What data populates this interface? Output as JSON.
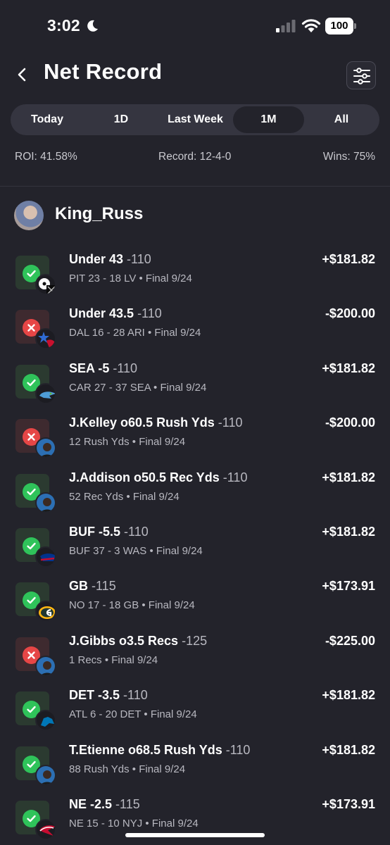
{
  "status_bar": {
    "time": "3:02",
    "battery": "100"
  },
  "header": {
    "title": "Net Record"
  },
  "tabs": [
    {
      "label": "Today",
      "active": false
    },
    {
      "label": "1D",
      "active": false
    },
    {
      "label": "Last Week",
      "active": false
    },
    {
      "label": "1M",
      "active": true
    },
    {
      "label": "All",
      "active": false
    }
  ],
  "stats": {
    "roi": "ROI: 41.58%",
    "record": "Record: 12-4-0",
    "wins": "Wins: 75%"
  },
  "user": {
    "name": "King_Russ"
  },
  "colors": {
    "background": "#23232b",
    "win": "#2fc35a",
    "loss": "#e64646"
  },
  "bets": [
    {
      "title": "Under 43",
      "odds": "-110",
      "detail": "PIT 23 - 18 LV • Final 9/24",
      "amount": "+$181.82",
      "result": "win",
      "icon": "steelers-raiders-logo"
    },
    {
      "title": "Under 43.5",
      "odds": "-110",
      "detail": "DAL 16 - 28 ARI • Final 9/24",
      "amount": "-$200.00",
      "result": "loss",
      "icon": "cowboys-cardinals-logo"
    },
    {
      "title": "SEA -5",
      "odds": "-110",
      "detail": "CAR 27 - 37 SEA • Final 9/24",
      "amount": "+$181.82",
      "result": "win",
      "icon": "seahawks-logo"
    },
    {
      "title": "J.Kelley o60.5 Rush Yds",
      "odds": "-110",
      "detail": "12 Rush Yds • Final 9/24",
      "amount": "-$200.00",
      "result": "loss",
      "icon": "player-headshot"
    },
    {
      "title": "J.Addison o50.5 Rec Yds",
      "odds": "-110",
      "detail": "52 Rec Yds • Final 9/24",
      "amount": "+$181.82",
      "result": "win",
      "icon": "player-headshot"
    },
    {
      "title": "BUF -5.5",
      "odds": "-110",
      "detail": "BUF 37 - 3 WAS • Final 9/24",
      "amount": "+$181.82",
      "result": "win",
      "icon": "bills-logo"
    },
    {
      "title": "GB",
      "odds": "-115",
      "detail": "NO 17 - 18 GB • Final 9/24",
      "amount": "+$173.91",
      "result": "win",
      "icon": "packers-logo"
    },
    {
      "title": "J.Gibbs o3.5 Recs",
      "odds": "-125",
      "detail": "1 Recs • Final 9/24",
      "amount": "-$225.00",
      "result": "loss",
      "icon": "player-headshot"
    },
    {
      "title": "DET -3.5",
      "odds": "-110",
      "detail": "ATL 6 - 20 DET • Final 9/24",
      "amount": "+$181.82",
      "result": "win",
      "icon": "lions-logo"
    },
    {
      "title": "T.Etienne o68.5 Rush Yds",
      "odds": "-110",
      "detail": "88 Rush Yds • Final 9/24",
      "amount": "+$181.82",
      "result": "win",
      "icon": "player-headshot"
    },
    {
      "title": "NE -2.5",
      "odds": "-115",
      "detail": "NE 15 - 10 NYJ • Final 9/24",
      "amount": "+$173.91",
      "result": "win",
      "icon": "patriots-logo"
    }
  ]
}
